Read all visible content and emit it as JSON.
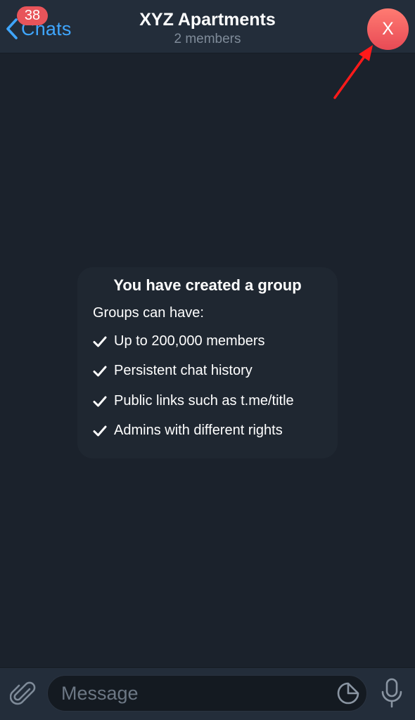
{
  "header": {
    "back_label": "Chats",
    "unread_badge": "38",
    "title": "XYZ Apartments",
    "subtitle": "2 members",
    "avatar_letter": "X"
  },
  "info": {
    "title": "You have created a group",
    "subtitle": "Groups can have:",
    "features": [
      "Up to 200,000 members",
      "Persistent chat history",
      "Public links such as t.me/title",
      "Admins with different rights"
    ]
  },
  "composer": {
    "placeholder": "Message"
  },
  "icons": {
    "back": "chevron-left-icon",
    "attach": "paperclip-icon",
    "sticker": "sticker-icon",
    "mic": "microphone-icon",
    "check": "checkmark-icon"
  },
  "colors": {
    "background": "#1b222c",
    "header": "#232d3a",
    "accent": "#3fa6ff",
    "badge": "#e8545a",
    "avatar": "#f0575c",
    "annotation_arrow": "#ff1a1a"
  }
}
